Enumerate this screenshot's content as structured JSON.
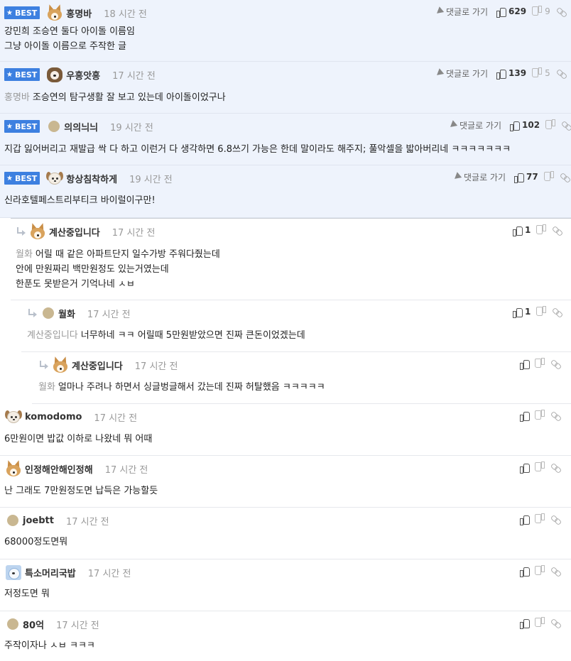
{
  "labels": {
    "best": "BEST",
    "goto_comment": "댓글로 가기"
  },
  "comments": [
    {
      "best": true,
      "nick": "홍명바",
      "time": "18 시간 전",
      "up": "629",
      "down": "9",
      "mention": "",
      "lines": [
        "강민희 조승연 둘다 아이돌 이름임",
        "그냥 아이돌 이름으로 주작한 글"
      ]
    },
    {
      "best": true,
      "nick": "우흥앗흥",
      "time": "17 시간 전",
      "up": "139",
      "down": "5",
      "mention": "홍명바",
      "lines": [
        "조승연의 탐구생활 잘 보고 있는데 아이돌이었구나"
      ]
    },
    {
      "best": true,
      "nick": "의의늬늬",
      "time": "19 시간 전",
      "up": "102",
      "down": "",
      "mention": "",
      "lines": [
        "지갑 잃어버리고 재발급 싹 다 하고 이런거 다 생각하면 6.8쓰기 가능은 한데 말이라도 해주지; 풀악셀을 밟아버리네 ㅋㅋㅋㅋㅋㅋㅋ"
      ]
    },
    {
      "best": true,
      "nick": "항상침착하게",
      "time": "19 시간 전",
      "up": "77",
      "down": "",
      "mention": "",
      "lines": [
        "신라호텔페스트리부티크 바이럴이구만!"
      ]
    },
    {
      "best": false,
      "nick": "계산중입니다",
      "time": "17 시간 전",
      "up": "1",
      "down": "",
      "mention": "월화",
      "lines": [
        "어릴 때 같은 아파트단지 일수가방 주워다줬는데",
        "안에 만원짜리 백만원정도 있는거였는데",
        "한푼도 못받은거 기억나네 ㅅㅂ"
      ]
    },
    {
      "best": false,
      "nick": "월화",
      "time": "17 시간 전",
      "up": "1",
      "down": "",
      "mention": "계산중입니다",
      "lines": [
        "너무하네 ㅋㅋ 어릴때 5만원받았으면 진짜 큰돈이었겠는데"
      ]
    },
    {
      "best": false,
      "nick": "계산중입니다",
      "time": "17 시간 전",
      "up": "",
      "down": "",
      "mention": "월화",
      "lines": [
        "얼마나 주려나 하면서 싱글벙글해서 갔는데 진짜 허탈했음 ㅋㅋㅋㅋㅋ"
      ]
    },
    {
      "best": false,
      "nick": "komodomo",
      "time": "17 시간 전",
      "up": "",
      "down": "",
      "mention": "",
      "lines": [
        "6만원이면 밥값 이하로 나왔네 뭐 어때"
      ]
    },
    {
      "best": false,
      "nick": "인정해안해인정해",
      "time": "17 시간 전",
      "up": "",
      "down": "",
      "mention": "",
      "lines": [
        "난 그래도 7만원정도면 납득은 가능할듯"
      ]
    },
    {
      "best": false,
      "nick": "joebtt",
      "time": "17 시간 전",
      "up": "",
      "down": "",
      "mention": "",
      "lines": [
        "68000정도면뭐"
      ]
    },
    {
      "best": false,
      "nick": "특소머리국밥",
      "time": "17 시간 전",
      "up": "",
      "down": "",
      "mention": "",
      "lines": [
        "저정도면 뭐"
      ]
    },
    {
      "best": false,
      "nick": "80억",
      "time": "17 시간 전",
      "up": "",
      "down": "",
      "mention": "",
      "lines": [
        "주작이자나 ㅅㅂ ㅋㅋㅋ"
      ]
    }
  ]
}
